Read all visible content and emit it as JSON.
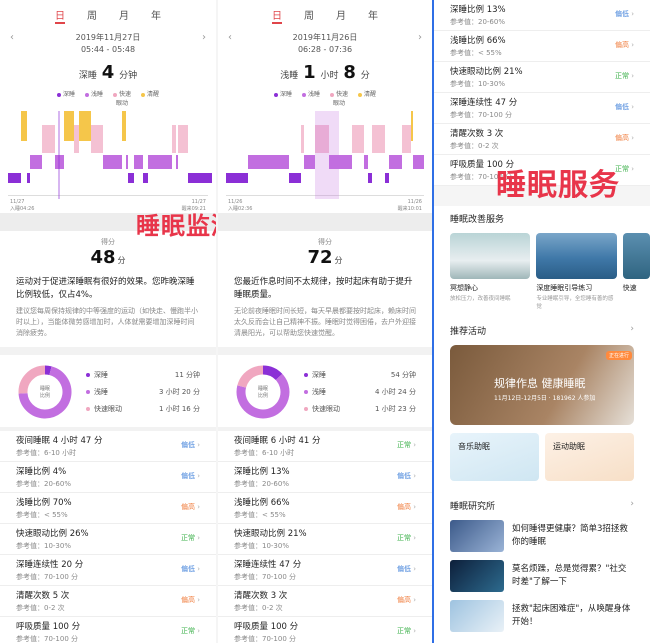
{
  "tabs": [
    "日",
    "周",
    "月",
    "年"
  ],
  "legend": [
    {
      "label": "深睡",
      "color": "#8b2fd6"
    },
    {
      "label": "浅睡",
      "color": "#c26ee0"
    },
    {
      "label": "快速\n眼动",
      "color": "#f0a7c0"
    },
    {
      "label": "清醒",
      "color": "#f5c64a"
    }
  ],
  "panel1": {
    "date": "2019年11月27日",
    "time_range": "05:44 - 05:48",
    "dur_label": "深睡",
    "dur_value": "4",
    "dur_unit": "分钟",
    "axis_left": "11/27\n入睡04:26",
    "axis_right": "11/27\n醒来09:21",
    "score_label": "得分",
    "score": "48",
    "score_unit": "分",
    "overlay": "睡眠监测",
    "desc_main": "运动对于促进深睡眠有很好的效果。您昨晚深睡比例较低，仅占4%。",
    "desc_sub": "建议您每周保持规律的中等强度的运动（如快走、慢跑半小时以上），当能体微劳感增加时，人体就需要增加深睡时间消除疲劳。",
    "donut_center": "睡眠\n比例",
    "donut_legend": [
      {
        "label": "深睡",
        "value": "11 分钟"
      },
      {
        "label": "浅睡",
        "value": "3 小时 20 分"
      },
      {
        "label": "快速眼动",
        "value": "1 小时 16 分"
      }
    ],
    "donut_fractions": [
      0.04,
      0.7,
      0.26
    ],
    "metrics": [
      {
        "title": "夜间睡眠  4 小时 47 分",
        "ref": "参考值：6-10 小时",
        "status": "偏低",
        "cls": "lo"
      },
      {
        "title": "深睡比例  4%",
        "ref": "参考值：20-60%",
        "status": "偏低",
        "cls": "lo"
      },
      {
        "title": "浅睡比例  70%",
        "ref": "参考值：< 55%",
        "status": "偏高",
        "cls": "hi"
      },
      {
        "title": "快速眼动比例  26%",
        "ref": "参考值：10-30%",
        "status": "正常",
        "cls": "ok"
      },
      {
        "title": "深睡连续性  20 分",
        "ref": "参考值：70-100 分",
        "status": "偏低",
        "cls": "lo"
      },
      {
        "title": "清醒次数  5 次",
        "ref": "参考值：0-2 次",
        "status": "偏高",
        "cls": "hi"
      },
      {
        "title": "呼吸质量  100 分",
        "ref": "参考值：70-100 分",
        "status": "正常",
        "cls": "ok"
      }
    ]
  },
  "panel2": {
    "date": "2019年11月26日",
    "time_range": "06:28 - 07:36",
    "dur_label": "浅睡",
    "dur_h": "1",
    "dur_h_unit": "小时",
    "dur_m": "8",
    "dur_m_unit": "分",
    "axis_left": "11/26\n入睡02:36",
    "axis_right": "11/26\n醒来10:01",
    "score_label": "得分",
    "score": "72",
    "score_unit": "分",
    "desc_main": "您最近作息时间不太规律，按时起床有助于提升睡眠质量。",
    "desc_sub": "无论前夜睡眠时间长短，每天早晨都要按时起床，赖床时间太久反而会让自己精神不振。睡眠时觉得困倦，去户外迎接清晨阳光，可以帮助您快速觉醒。",
    "donut_center": "睡眠\n比例",
    "donut_legend": [
      {
        "label": "深睡",
        "value": "54 分钟"
      },
      {
        "label": "浅睡",
        "value": "4 小时 24 分"
      },
      {
        "label": "快速眼动",
        "value": "1 小时 23 分"
      }
    ],
    "donut_fractions": [
      0.13,
      0.66,
      0.21
    ],
    "metrics": [
      {
        "title": "夜间睡眠  6 小时 41 分",
        "ref": "参考值：6-10 小时",
        "status": "正常",
        "cls": "ok"
      },
      {
        "title": "深睡比例  13%",
        "ref": "参考值：20-60%",
        "status": "偏低",
        "cls": "lo"
      },
      {
        "title": "浅睡比例  66%",
        "ref": "参考值：< 55%",
        "status": "偏高",
        "cls": "hi"
      },
      {
        "title": "快速眼动比例  21%",
        "ref": "参考值：10-30%",
        "status": "正常",
        "cls": "ok"
      },
      {
        "title": "深睡连续性  47 分",
        "ref": "参考值：70-100 分",
        "status": "偏低",
        "cls": "lo"
      },
      {
        "title": "清醒次数  3 次",
        "ref": "参考值：0-2 次",
        "status": "偏高",
        "cls": "hi"
      },
      {
        "title": "呼吸质量  100 分",
        "ref": "参考值：70-100 分",
        "status": "正常",
        "cls": "ok"
      }
    ]
  },
  "panel3": {
    "metrics": [
      {
        "title": "深睡比例  13%",
        "ref": "参考值：20-60%",
        "status": "偏低",
        "cls": "lo"
      },
      {
        "title": "浅睡比例  66%",
        "ref": "参考值：< 55%",
        "status": "偏高",
        "cls": "hi"
      },
      {
        "title": "快速眼动比例  21%",
        "ref": "参考值：10-30%",
        "status": "正常",
        "cls": "ok"
      },
      {
        "title": "深睡连续性  47 分",
        "ref": "参考值：70-100 分",
        "status": "偏低",
        "cls": "lo"
      },
      {
        "title": "清醒次数  3 次",
        "ref": "参考值：0-2 次",
        "status": "偏高",
        "cls": "hi"
      },
      {
        "title": "呼吸质量  100 分",
        "ref": "参考值：70-100 分",
        "status": "正常",
        "cls": "ok"
      }
    ],
    "overlay": "睡眠服务",
    "service_title": "睡眠改善服务",
    "services": [
      {
        "name": "冥想静心",
        "desc": "放松压力，改善夜间睡眠"
      },
      {
        "name": "深度睡眠引导练习",
        "desc": "专业睡眠引导，全您睡有善的感觉"
      },
      {
        "name": "快速",
        "desc": ""
      }
    ],
    "activity_title": "推荐活动",
    "banner_title": "规律作息 健康睡眠",
    "banner_sub": "11月12日-12月5日 · 181962 人参加",
    "banner_tag": "正在进行",
    "tiles": [
      "音乐助眠",
      "运动助眠"
    ],
    "research_title": "睡眠研究所",
    "articles": [
      "如何睡得更健康？简单3招拯救你的睡眠",
      "莫名烦躁，总是觉得累？\"社交时差\"了解一下",
      "拯救\"起床困难症\"，从唤醒身体开始！"
    ]
  }
}
